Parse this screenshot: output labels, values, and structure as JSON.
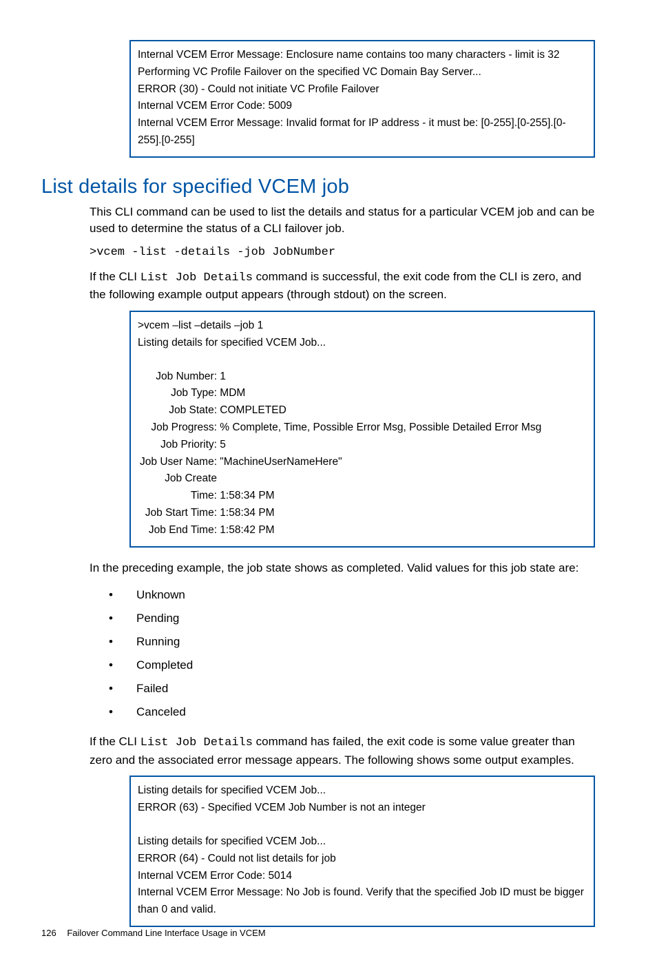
{
  "box1": {
    "l1": "Internal VCEM Error Message: Enclosure name contains too many characters - limit is 32",
    "l2": "Performing VC Profile Failover on the specified VC Domain Bay Server...",
    "l3": "ERROR (30) - Could not initiate VC Profile Failover",
    "l4": "Internal VCEM Error Code: 5009",
    "l5": "Internal VCEM Error Message: Invalid format for IP address - it must be: [0-255].[0-255].[0-255].[0-255]"
  },
  "heading": "List details for specified VCEM job",
  "para1": "This CLI command can be used to list the details and status for a particular VCEM job and can be used to determine the status of a CLI failover job.",
  "cmd1": ">vcem -list -details -job JobNumber",
  "para2_a": "If the CLI ",
  "para2_code": "List Job Details",
  "para2_b": " command is successful, the exit code from the CLI is zero, and the following example output appears (through stdout) on the screen.",
  "box2": {
    "l1": ">vcem –list –details –job 1",
    "l2": "Listing details for specified VCEM Job...",
    "k_jobnumber": "Job Number:",
    "v_jobnumber": " 1",
    "k_jobtype": "Job Type:",
    "v_jobtype": " MDM",
    "k_jobstate": "Job State:",
    "v_jobstate": " COMPLETED",
    "k_jobprogress": "Job Progress:",
    "v_jobprogress": " % Complete, Time, Possible Error Msg, Possible Detailed Error Msg",
    "k_jobpriority": "Job Priority:",
    "v_jobpriority": " 5",
    "k_jobuser": "Job User Name:",
    "v_jobuser": " \"MachineUserNameHere\"",
    "k_jobcreate": "Job Create Time:",
    "v_jobcreate": " 1:58:34 PM",
    "k_jobstart": "Job Start Time:",
    "v_jobstart": " 1:58:34 PM",
    "k_jobend": "Job End Time:",
    "v_jobend": " 1:58:42 PM"
  },
  "para3": "In the preceding example, the job state shows as completed. Valid values for this job state are:",
  "bullets": {
    "b1": "Unknown",
    "b2": "Pending",
    "b3": "Running",
    "b4": "Completed",
    "b5": "Failed",
    "b6": "Canceled"
  },
  "para4_a": "If the CLI ",
  "para4_code": "List Job Details",
  "para4_b": " command has failed, the exit code is some value greater than zero and the associated error message appears. The following shows some output examples.",
  "box3": {
    "l1": "Listing details for specified VCEM Job...",
    "l2": "ERROR (63) - Specified VCEM Job Number is not an integer",
    "l3": "Listing details for specified VCEM Job...",
    "l4": "ERROR (64) - Could not list details for job",
    "l5": "Internal VCEM Error Code: 5014",
    "l6": "Internal VCEM Error Message: No Job is found. Verify that the specified Job ID must be bigger than 0 and valid."
  },
  "footer": {
    "page": "126",
    "title": "Failover Command Line Interface Usage in VCEM"
  }
}
